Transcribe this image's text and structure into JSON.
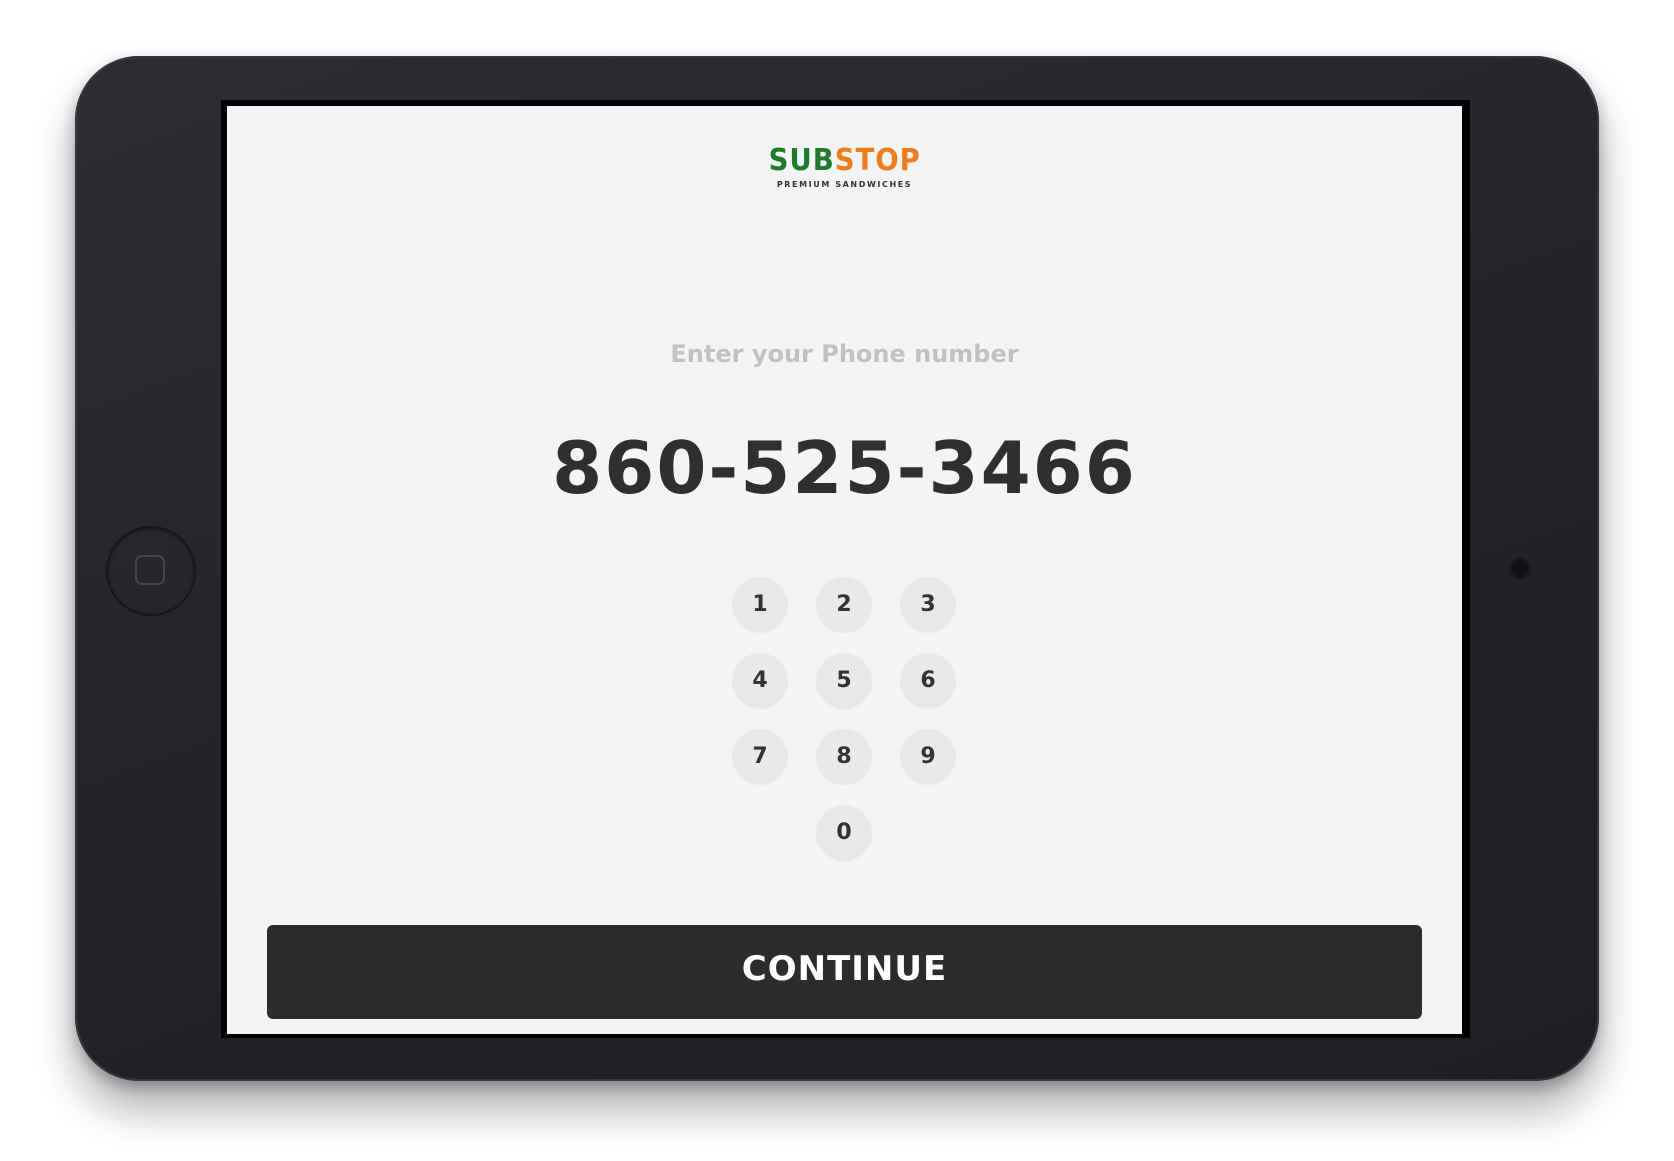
{
  "logo": {
    "part1": "SUB",
    "part2": "STOP",
    "tagline": "PREMIUM SANDWICHES",
    "colors": {
      "sub": "#1f7a2a",
      "stop": "#f07d1c"
    }
  },
  "prompt": "Enter your Phone number",
  "phone_number": "860-525-3466",
  "keypad": {
    "keys": [
      "1",
      "2",
      "3",
      "4",
      "5",
      "6",
      "7",
      "8",
      "9",
      "0"
    ]
  },
  "continue_label": "CONTINUE",
  "device": {
    "home_button_icon": "home-button-icon",
    "camera_icon": "camera-icon"
  }
}
